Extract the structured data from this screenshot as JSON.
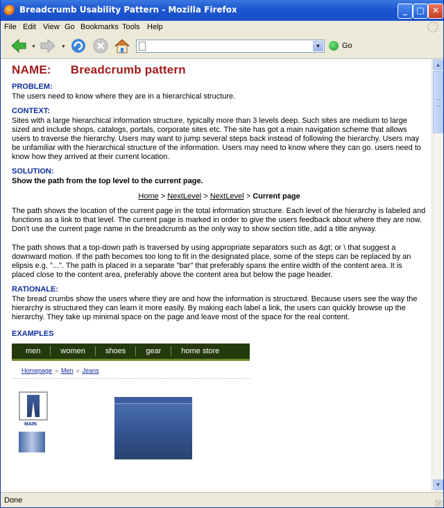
{
  "window": {
    "title": "Breadcrumb Usability Pattern - Mozilla Firefox",
    "min": "_",
    "max": "□",
    "close": "✕"
  },
  "menu": [
    "File",
    "Edit",
    "View",
    "Go",
    "Bookmarks",
    "Tools",
    "Help"
  ],
  "toolbar": {
    "url_value": "",
    "go_label": "Go"
  },
  "page": {
    "name_label": "NAME:",
    "name_value": "Breadcrumb pattern",
    "problem_heading": "PROBLEM:",
    "problem_text": "The users need to know where they are in a hierarchical structure.",
    "context_heading": "CONTEXT:",
    "context_text": "Sites with a large hierarchical information structure, typically more than 3 levels deep. Such sites are medium to large sized and include shops, catalogs, portals, corporate sites etc. The site has got a main navigation scheme that allows users to traverse the hierarchy. Users may want to jump several steps back instead of following the hierarchy. Users may be unfamiliar with the hierarchical structure of the information. Users may need to know where they can go. users need to know how they arrived at their current location.",
    "solution_heading": "SOLUTION:",
    "solution_bold": "Show the path from the top level to the current page.",
    "demo": {
      "home": "Home",
      "sep": ">",
      "level1": "NextLevel",
      "level2": "NextLevel",
      "current": "Current page"
    },
    "solution_p1": "The path shows the location of the current page in the total information structure. Each level of the hierarchy is labeled and functions as a link to that level. The current page is marked in order to give the users feedback about where they are now. Don't use the current page name in the breadcrumb as the only way to show section title, add a title anyway.",
    "solution_p2": "The path shows that a top-down path is traversed by using appropriate separators such as &gt; or \\ that suggest a downward motion. If the path becomes too long to fit in the designated place, some of the steps can be replaced by an elipsis e.g. \"...\". The path is placed in a separate \"bar\" that preferably spans the entire width of the content area. It is placed close to the content area, preferably above the content area but below the page header.",
    "rationale_heading": "RATIONALE:",
    "rationale_text": "The bread crumbs show the users where they are and how the information is structured. Because users see the way the hierarchy is structured they can learn it more easily. By making each label a link, the users can quickly browse up the hierarchy. They take up minimal space on the page and leave most of the space for the real content.",
    "examples_heading": "EXAMPLES",
    "example": {
      "nav": [
        "men",
        "women",
        "shoes",
        "gear",
        "home store"
      ],
      "crumbs": [
        "Homepage",
        "Men",
        "Jeans"
      ],
      "crumb_sep": "»",
      "thumb_label": "MAIN"
    }
  },
  "status": {
    "text": "Done"
  },
  "colors": {
    "heading_red": "#a01b1b",
    "heading_blue": "#0e2d9c",
    "example_nav_bg": "#243a0c"
  }
}
